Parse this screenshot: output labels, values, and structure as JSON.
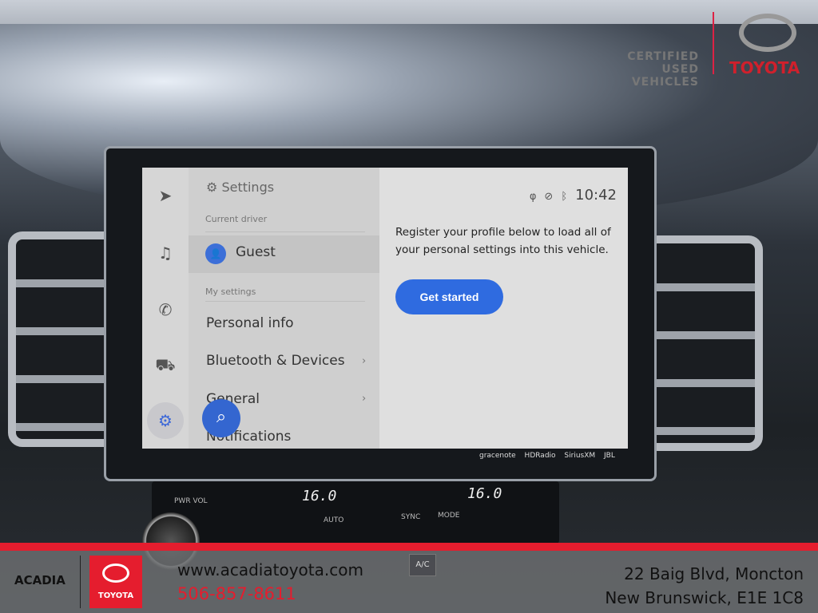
{
  "screen": {
    "rail": [
      {
        "icon": "navigation-icon"
      },
      {
        "icon": "music-icon"
      },
      {
        "icon": "phone-icon"
      },
      {
        "icon": "car-icon"
      },
      {
        "icon": "gear-icon",
        "selected": true
      }
    ],
    "settings": {
      "title": "Settings",
      "current_driver_label": "Current driver",
      "driver": "Guest",
      "my_settings_label": "My settings",
      "items": [
        {
          "label": "Personal info"
        },
        {
          "label": "Bluetooth & Devices",
          "chevron": "›"
        },
        {
          "label": "General",
          "chevron": "›"
        },
        {
          "label": "Notifications"
        }
      ]
    },
    "status": {
      "time": "10:42",
      "icons": [
        "wireless-charging-icon",
        "voice-muted-icon",
        "bluetooth-icon"
      ]
    },
    "message": "Register your profile below to load all of your personal settings into this vehicle.",
    "get_started": "Get started",
    "brands": "gracenote HDRadio SiriusXM JBL",
    "accent": "#2f6be0"
  },
  "climate": {
    "left_temp": "16.0",
    "right_temp": "16.0",
    "labels": {
      "pwr_vol": "PWR VOL",
      "auto": "AUTO",
      "sync": "SYNC",
      "mode": "MODE",
      "ac": "A/C"
    }
  },
  "top_brand": {
    "certified": "CERTIFIED USED VEHICLES",
    "toyota": "TOYOTA"
  },
  "footer": {
    "dealer": "ACADIA",
    "logo_text": "TOYOTA",
    "website": "www.acadiatoyota.com",
    "phone": "506-857-8611",
    "address_line1": "22 Baig Blvd, Moncton",
    "address_line2": "New Brunswick, E1E 1C8",
    "brand_color": "#e51d2e"
  }
}
